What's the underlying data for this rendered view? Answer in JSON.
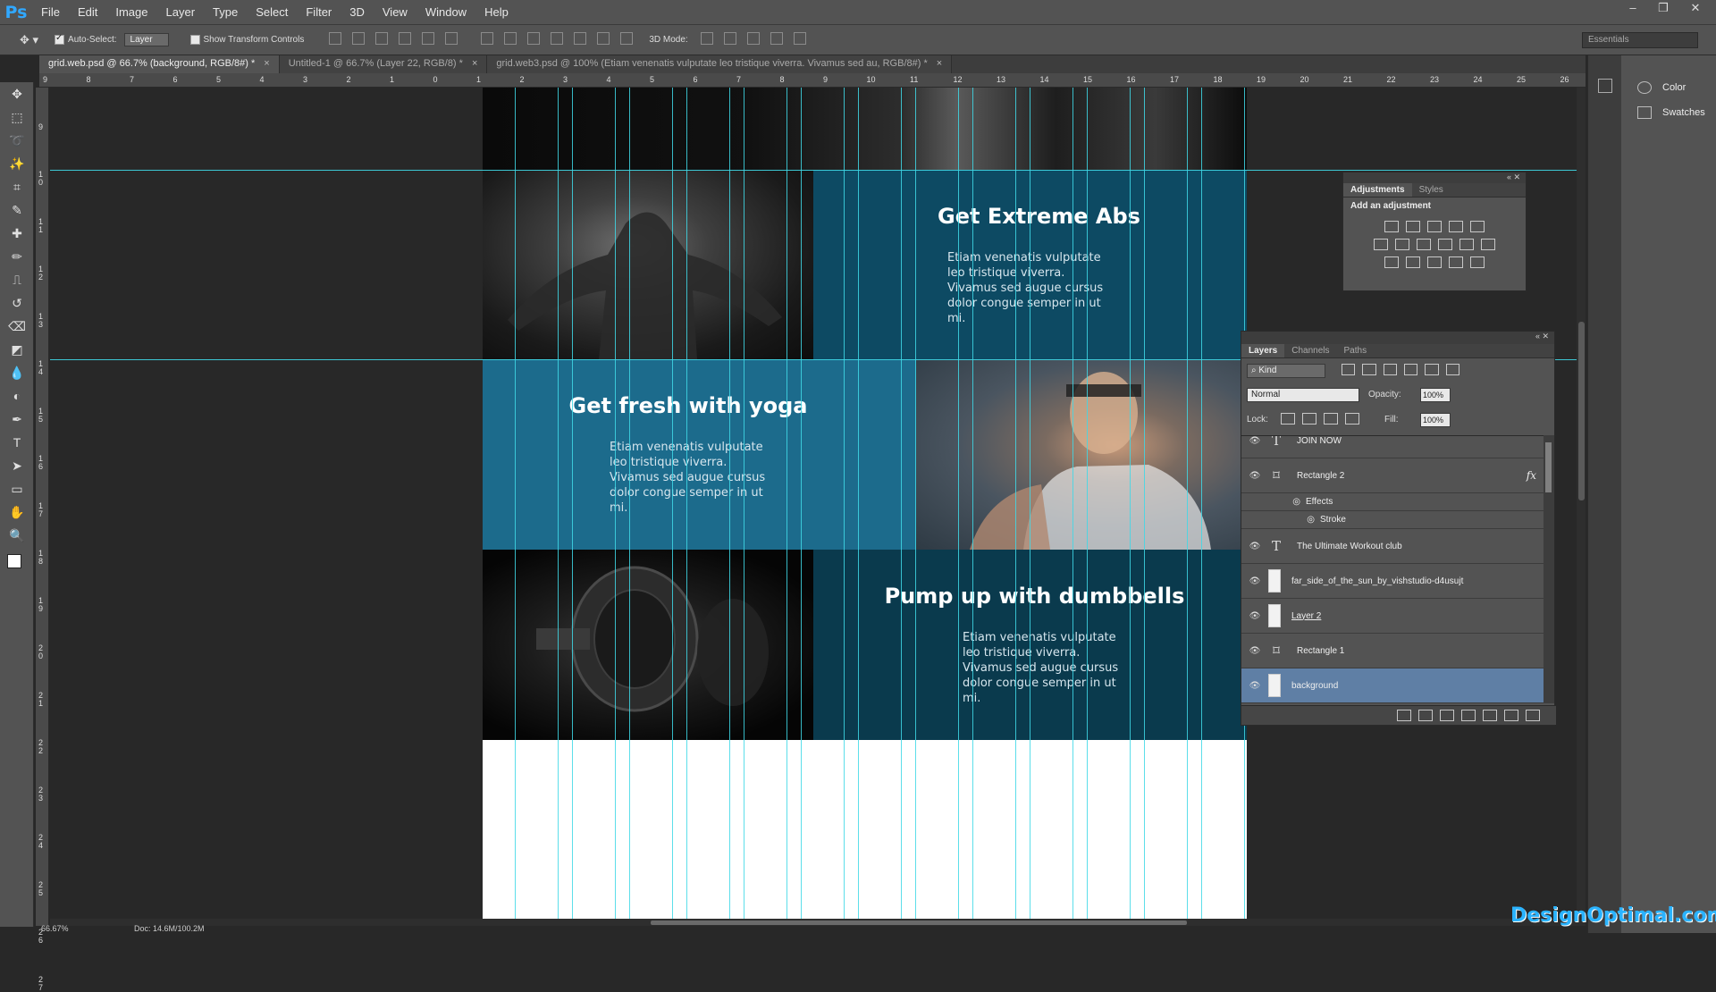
{
  "app": {
    "logo": "Ps",
    "menu": [
      "File",
      "Edit",
      "Image",
      "Layer",
      "Type",
      "Select",
      "Filter",
      "3D",
      "View",
      "Window",
      "Help"
    ],
    "win_controls": [
      "–",
      "❐",
      "✕"
    ]
  },
  "options": {
    "auto_select_label": "Auto-Select:",
    "auto_select_value": "Layer",
    "show_transform": "Show Transform Controls",
    "mode_3d": "3D Mode:",
    "workspace": "Essentials"
  },
  "tabs": [
    {
      "label": "grid.web.psd @ 66.7% (background, RGB/8#) *",
      "active": true
    },
    {
      "label": "Untitled-1 @ 66.7% (Layer 22, RGB/8) *",
      "active": false
    },
    {
      "label": "grid.web3.psd @ 100% (Etiam venenatis vulputate leo tristique viverra. Vivamus sed au, RGB/8#) *",
      "active": false
    }
  ],
  "ruler_h": [
    "9",
    "8",
    "7",
    "6",
    "5",
    "4",
    "3",
    "2",
    "1",
    "0",
    "1",
    "2",
    "3",
    "4",
    "5",
    "6",
    "7",
    "8",
    "9",
    "10",
    "11",
    "12",
    "13",
    "14",
    "15",
    "16",
    "17",
    "18",
    "19",
    "20",
    "21",
    "22",
    "23",
    "24",
    "25",
    "26"
  ],
  "ruler_v": [
    "9",
    "1 0",
    "1 1",
    "1 2",
    "1 3",
    "1 4",
    "1 5",
    "1 6",
    "1 7",
    "1 8",
    "1 9",
    "2 0",
    "2 1",
    "2 2",
    "2 3",
    "2 4",
    "2 5",
    "2 6",
    "2 7"
  ],
  "tools": [
    "move-icon",
    "marquee-icon",
    "lasso-icon",
    "magic-wand-icon",
    "crop-icon",
    "eyedropper-icon",
    "healing-icon",
    "brush-icon",
    "stamp-icon",
    "history-brush-icon",
    "eraser-icon",
    "paint-bucket-icon",
    "blur-icon",
    "dodge-icon",
    "pen-icon",
    "type-icon",
    "path-select-icon",
    "shape-icon",
    "hand-icon",
    "zoom-icon"
  ],
  "doc": {
    "panel1_title": "Get Extreme Abs",
    "panel2_title": "Get fresh with yoga",
    "panel3_title": "Pump up with dumbbells",
    "body_text": "Etiam venenatis vulputate leo tristique viverra. Vivamus sed augue cursus dolor congue semper in ut mi.",
    "colors": {
      "teal_dark": "#0d4a63",
      "teal_mid": "#1c6b8c",
      "teal_deep": "#0a3a4d",
      "guide": "#3fd8e6"
    }
  },
  "status": {
    "zoom": "66.67%",
    "doc": "Doc: 14.6M/100.2M"
  },
  "right_dock": [
    {
      "label": "Color",
      "icon": "color-wheel-icon"
    },
    {
      "label": "Swatches",
      "icon": "swatches-grid-icon"
    }
  ],
  "adjustments": {
    "tabs": [
      "Adjustments",
      "Styles"
    ],
    "add_label": "Add an adjustment"
  },
  "layers": {
    "tabs": [
      "Layers",
      "Channels",
      "Paths"
    ],
    "kind": "Kind",
    "blend": "Normal",
    "opacity_label": "Opacity:",
    "opacity": "100%",
    "lock_label": "Lock:",
    "fill_label": "Fill:",
    "fill": "100%",
    "items": [
      {
        "name": "JOIN NOW",
        "type": "text"
      },
      {
        "name": "Rectangle 2",
        "type": "shape",
        "fx": "fx"
      },
      {
        "name": "Effects",
        "type": "effect"
      },
      {
        "name": "Stroke",
        "type": "effect"
      },
      {
        "name": "The Ultimate   Workout club",
        "type": "text"
      },
      {
        "name": "far_side_of_the_sun_by_vishstudio-d4usujt",
        "type": "image"
      },
      {
        "name": "Layer 2",
        "type": "image"
      },
      {
        "name": "Rectangle 1",
        "type": "shape"
      },
      {
        "name": "background",
        "type": "image",
        "selected": true
      }
    ]
  },
  "watermark": "DesignOptimal.com"
}
